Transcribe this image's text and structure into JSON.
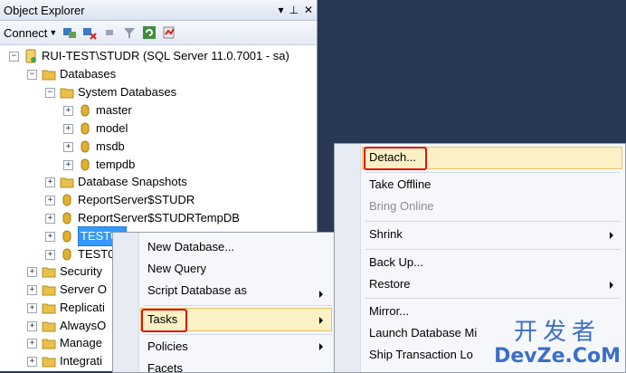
{
  "panel": {
    "title": "Object Explorer",
    "controls": {
      "pin": "▾",
      "autohide": "⊥",
      "close": "✕"
    }
  },
  "toolbar": {
    "connect_label": "Connect"
  },
  "tree": {
    "server": "RUI-TEST\\STUDR (SQL Server 11.0.7001 - sa)",
    "databases": "Databases",
    "system_databases": "System Databases",
    "system_items": [
      "master",
      "model",
      "msdb",
      "tempdb"
    ],
    "snapshots": "Database Snapshots",
    "db_items": [
      "ReportServer$STUDR",
      "ReportServer$STUDRTempDB",
      "TEST01",
      "TEST0"
    ],
    "top_items": [
      "Security",
      "Server O",
      "Replicati",
      "AlwaysO",
      "Manage",
      "Integrati"
    ]
  },
  "context_menu": {
    "items": [
      "New Database...",
      "New Query",
      "Script Database as",
      "Tasks",
      "Policies",
      "Facets"
    ]
  },
  "tasks_menu": {
    "items": [
      "Detach...",
      "Take Offline",
      "Bring Online",
      "Shrink",
      "Back Up...",
      "Restore",
      "Mirror...",
      "Launch Database Mi",
      "Ship Transaction Lo"
    ]
  },
  "watermark": {
    "top": "开发者",
    "bottom": "DevZe.CoM"
  },
  "colors": {
    "background": "#293955",
    "selection": "#3399ff",
    "highlight_outline": "#e01010",
    "folder": "#e8c04a",
    "database": "#e0b030"
  }
}
